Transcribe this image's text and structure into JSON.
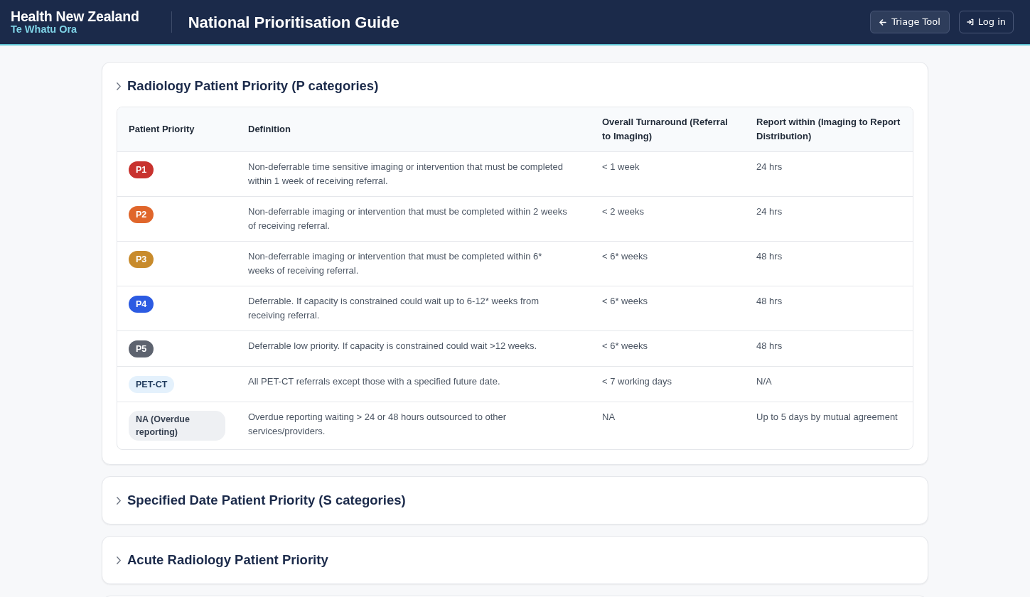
{
  "header": {
    "brand": {
      "name": "Health New Zealand",
      "subtitle": "Te Whatu Ora"
    },
    "title": "National Prioritisation Guide",
    "buttons": [
      {
        "label": "Triage Tool",
        "kind": "back"
      },
      {
        "label": "Log in",
        "kind": "login"
      }
    ]
  },
  "sections": [
    {
      "title": "Radiology Patient Priority (P categories)",
      "table": {
        "columns": [
          "Patient Priority",
          "Definition",
          "Overall Turnaround (Referral to Imaging)",
          "Report within (Imaging to Report Distribution)"
        ],
        "rows": [
          {
            "priority": {
              "label": "P1",
              "kind": "solid",
              "color": "#c8322e"
            },
            "definition": "Non-deferrable time sensitive imaging or intervention that must be completed within 1 week of receiving referral.",
            "turnaround": "< 1 week",
            "report": "24 hrs"
          },
          {
            "priority": {
              "label": "P2",
              "kind": "solid",
              "color": "#e0662b"
            },
            "definition": "Non-deferrable imaging or intervention that must be completed within 2 weeks of receiving referral.",
            "turnaround": "< 2 weeks",
            "report": "24 hrs"
          },
          {
            "priority": {
              "label": "P3",
              "kind": "solid",
              "color": "#c88b2c"
            },
            "definition": "Non-deferrable imaging or intervention that must be completed within 6* weeks of receiving referral.",
            "turnaround": "< 6* weeks",
            "report": "48 hrs"
          },
          {
            "priority": {
              "label": "P4",
              "kind": "solid",
              "color": "#2c5be2"
            },
            "definition": "Deferrable. If capacity is constrained could wait up to 6-12* weeks from receiving referral.",
            "turnaround": "< 6* weeks",
            "report": "48 hrs"
          },
          {
            "priority": {
              "label": "P5",
              "kind": "solid",
              "color": "#5d636f"
            },
            "definition": "Deferrable low priority. If capacity is constrained could wait >12 weeks.",
            "turnaround": "< 6* weeks",
            "report": "48 hrs"
          },
          {
            "priority": {
              "label": "PET-CT",
              "kind": "tint",
              "color": "#e4f1fc"
            },
            "definition": "All PET-CT referrals except those with a specified future date.",
            "turnaround": "< 7 working days",
            "report": "N/A"
          },
          {
            "priority": {
              "label": "NA (Overdue reporting)",
              "kind": "plain",
              "color": "#eef0f3"
            },
            "definition": "Overdue reporting waiting > 24 or 48 hours outsourced to other services/providers.",
            "turnaround": "NA",
            "report": "Up to 5 days by mutual agreement"
          }
        ]
      }
    },
    {
      "title": "Specified Date Patient Priority (S categories)"
    },
    {
      "title": "Acute Radiology Patient Priority"
    }
  ]
}
